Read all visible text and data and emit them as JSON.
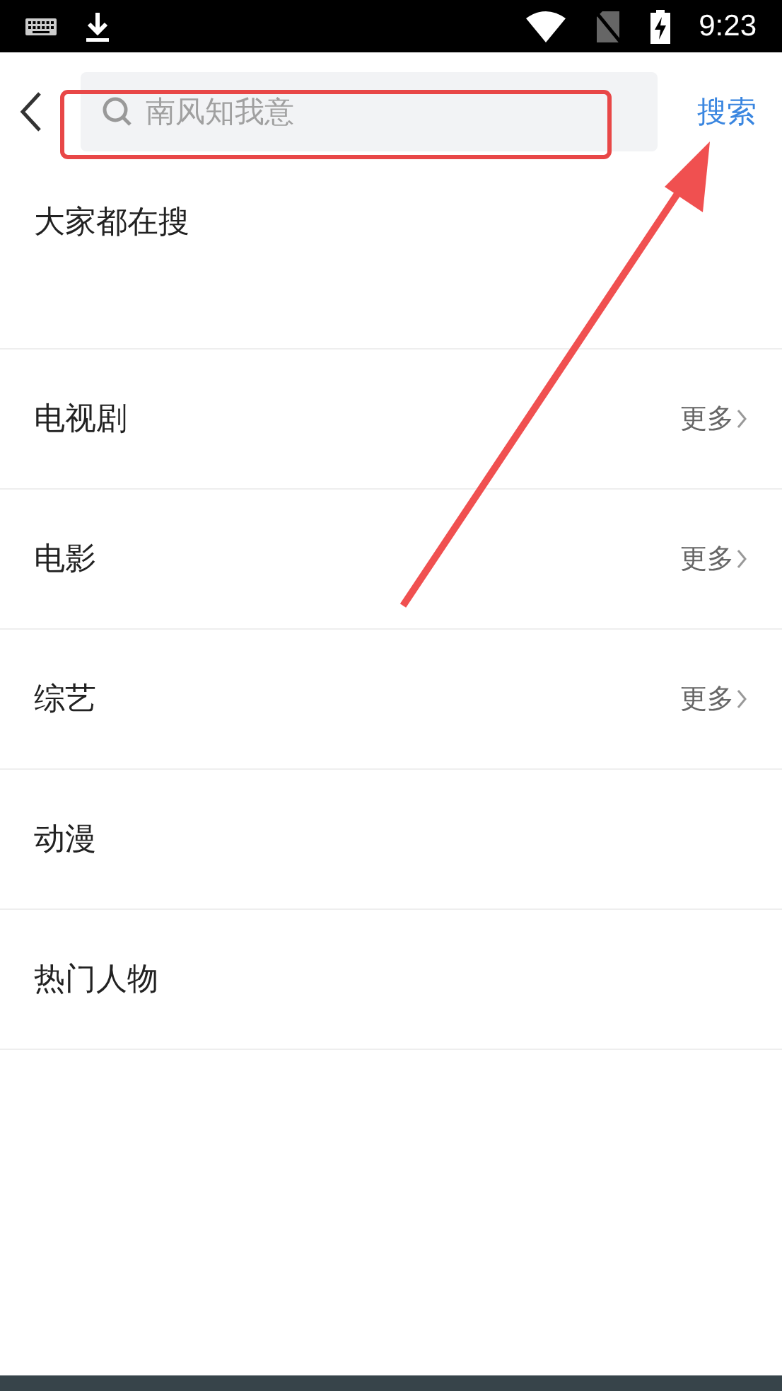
{
  "status_bar": {
    "time": "9:23"
  },
  "search": {
    "placeholder": "南风知我意",
    "button": "搜索"
  },
  "hot_search": {
    "title": "大家都在搜"
  },
  "sections": [
    {
      "title": "电视剧",
      "more": "更多"
    },
    {
      "title": "电影",
      "more": "更多"
    },
    {
      "title": "综艺",
      "more": "更多"
    },
    {
      "title": "动漫"
    },
    {
      "title": "热门人物"
    }
  ]
}
